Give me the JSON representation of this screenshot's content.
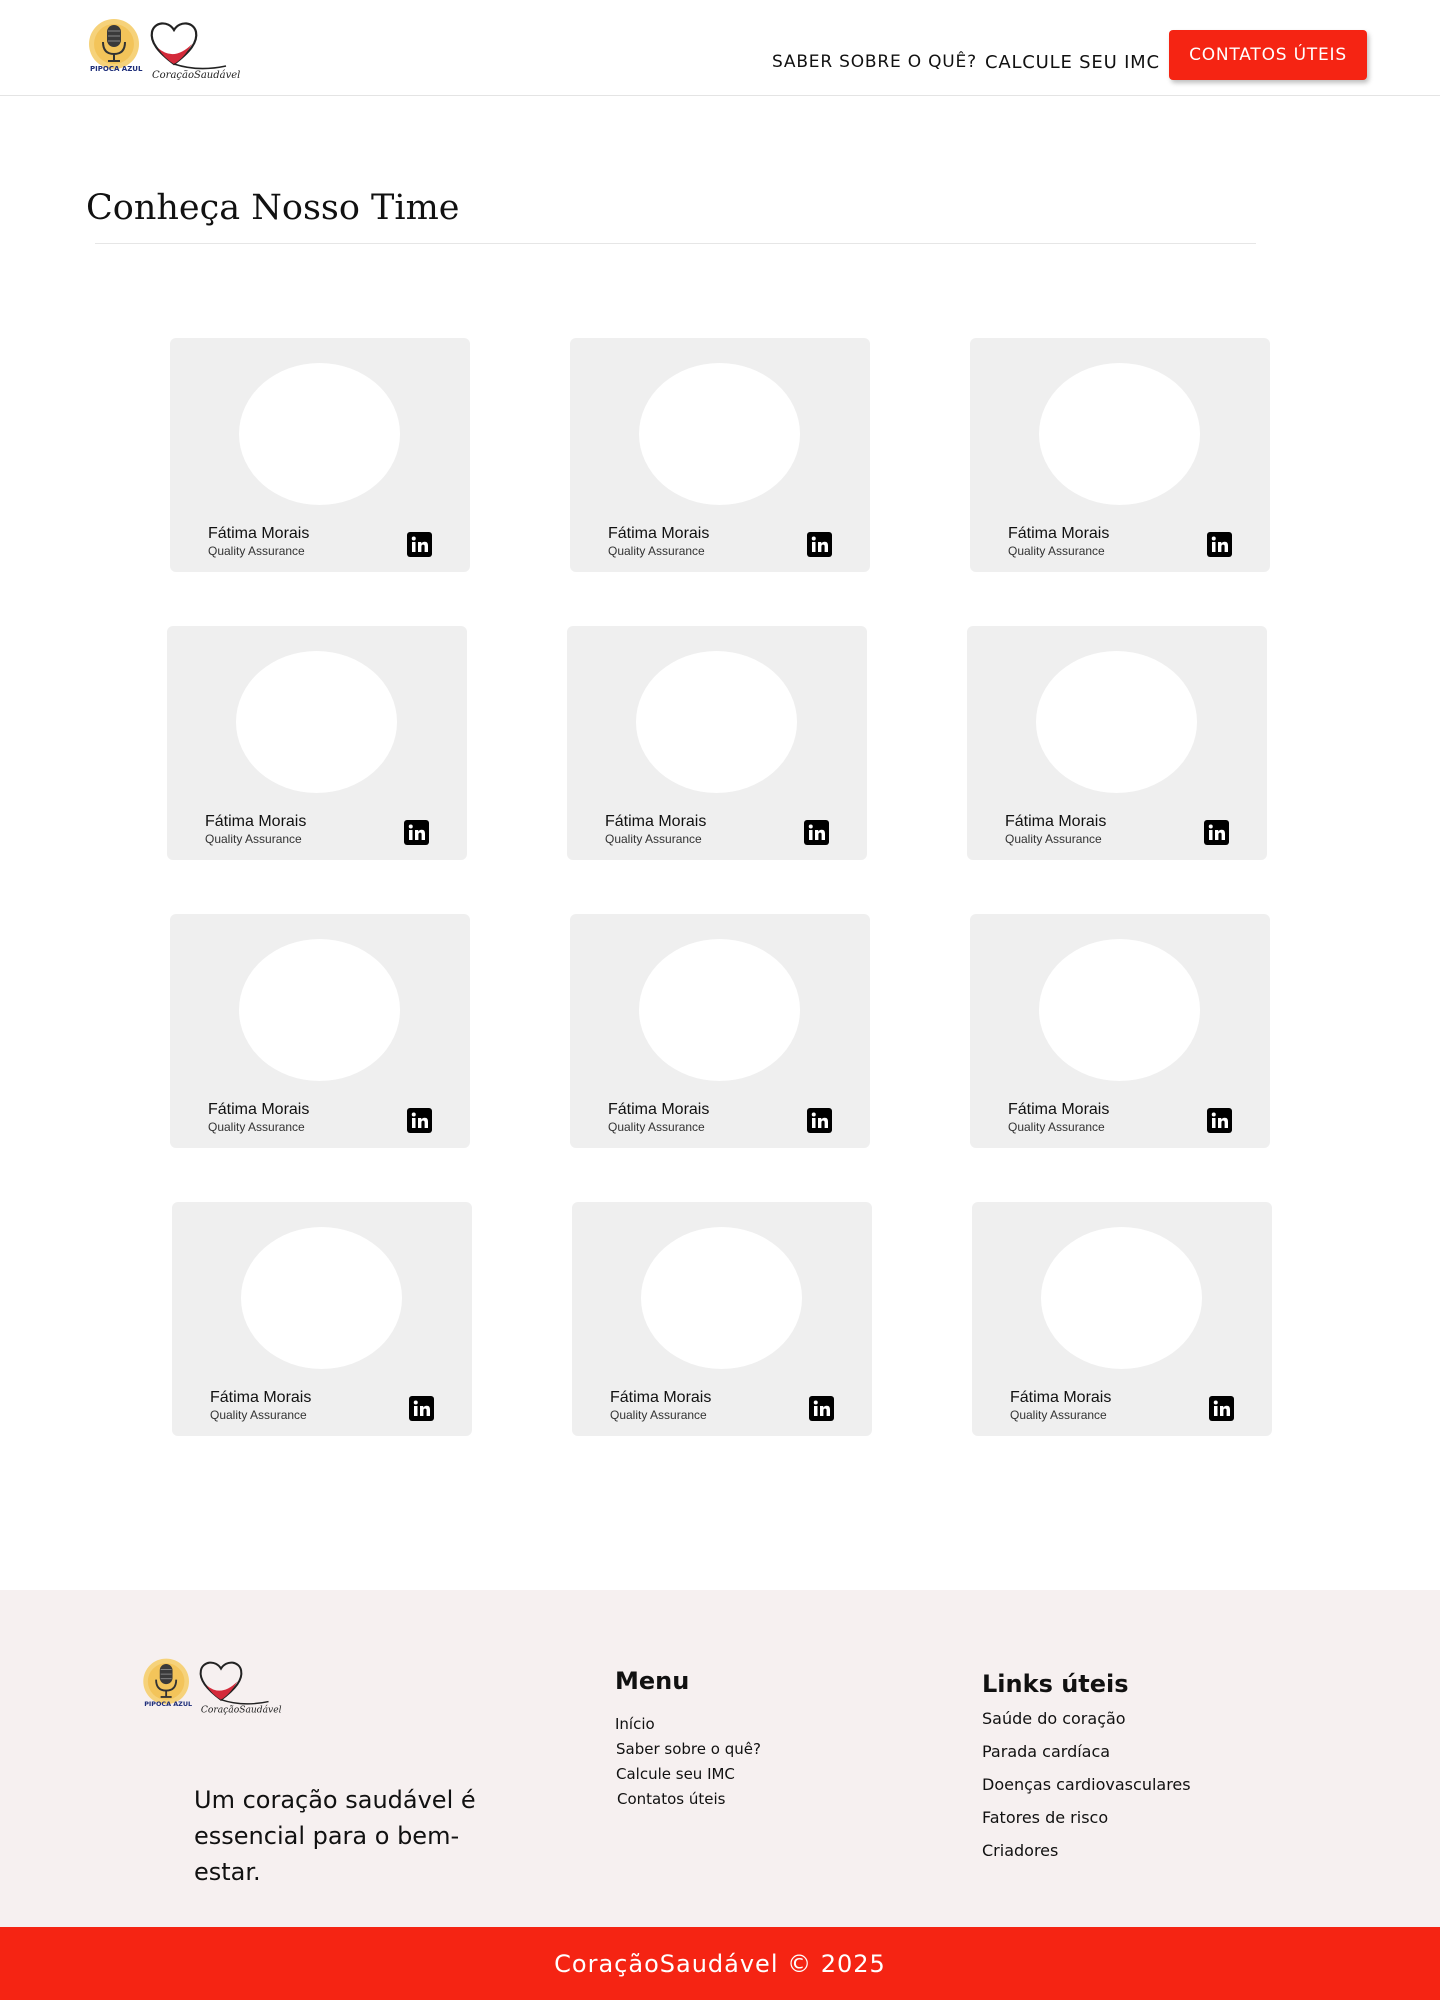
{
  "header": {
    "logo_text": "PIPOCA AZUL",
    "brand_text": "CoraçãoSaudável",
    "nav": {
      "saber": "SABER SOBRE O QUÊ?",
      "imc": "CALCULE SEU IMC",
      "contatos": "CONTATOS ÚTEIS"
    }
  },
  "section": {
    "title": "Conheça Nosso Time"
  },
  "team": [
    {
      "name": "Fátima Morais",
      "role": "Quality Assurance"
    },
    {
      "name": "Fátima Morais",
      "role": "Quality Assurance"
    },
    {
      "name": "Fátima Morais",
      "role": "Quality Assurance"
    },
    {
      "name": "Fátima Morais",
      "role": "Quality Assurance"
    },
    {
      "name": "Fátima Morais",
      "role": "Quality Assurance"
    },
    {
      "name": "Fátima Morais",
      "role": "Quality Assurance"
    },
    {
      "name": "Fátima Morais",
      "role": "Quality Assurance"
    },
    {
      "name": "Fátima Morais",
      "role": "Quality Assurance"
    },
    {
      "name": "Fátima Morais",
      "role": "Quality Assurance"
    },
    {
      "name": "Fátima Morais",
      "role": "Quality Assurance"
    },
    {
      "name": "Fátima Morais",
      "role": "Quality Assurance"
    },
    {
      "name": "Fátima Morais",
      "role": "Quality Assurance"
    }
  ],
  "footer": {
    "tagline": "Um coração saudável é essencial para o bem-estar.",
    "menu": {
      "title": "Menu",
      "items": [
        "Início",
        "Saber sobre o quê?",
        "Calcule seu IMC",
        "Contatos úteis"
      ]
    },
    "links": {
      "title": "Links úteis",
      "items": [
        "Saúde do coração",
        "Parada cardíaca",
        "Doenças cardiovasculares",
        "Fatores de risco",
        "Criadores"
      ]
    },
    "copyright": "CoraçãoSaudável © 2025"
  },
  "colors": {
    "accent": "#f52413",
    "card_bg": "#efefef",
    "footer_bg": "#f6f0f0",
    "heart": "#d42a3a"
  },
  "icons": [
    "microphone-logo-icon",
    "heart-logo-icon",
    "linkedin-icon"
  ]
}
